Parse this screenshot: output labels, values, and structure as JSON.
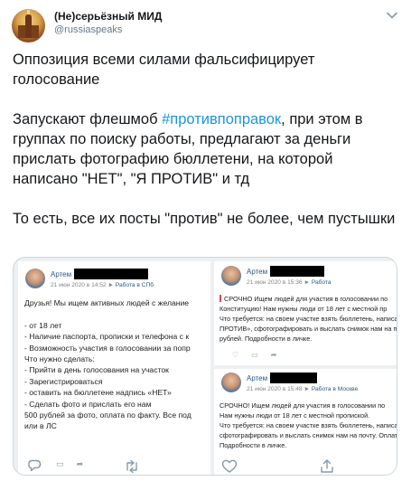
{
  "tweet": {
    "author_name": "(Не)серьёзный МИД",
    "author_handle": "@russiaspeaks",
    "paragraph1": "Оппозиция всеми силами фальсифицирует голосование",
    "paragraph2_before": "Запускают флешмоб ",
    "hashtag": "#противпоправок",
    "paragraph2_after": ", при этом в группах по поиску работы, предлагают за деньги прислать фотографию бюллетени, на которой написано \"НЕТ\", \"Я ПРОТИВ\" и тд",
    "paragraph3": "То есть, все их посты \"против\" не более, чем пустышки"
  },
  "media": {
    "post_left": {
      "author": "Артем",
      "date": "21 июн 2020 в 14:52",
      "arrow": "►",
      "group": "Работа в СПб",
      "lines": [
        "Друзья! Мы ищем активных людей с желание",
        "",
        "- от 18 лет",
        "- Наличие паспорта, прописки и телефона с к",
        "- Возможность участия в голосовании за попр",
        "Что нужно сделать:",
        "- Прийти в день голосования на участок",
        "- Зарегистрироваться",
        "- оставить на бюллетене надпись «НЕТ»",
        "- Сделать фото и прислать его нам",
        "500 рублей за фото, оплата по факту. Все под",
        "или в ЛС"
      ]
    },
    "post_right_top": {
      "author": "Артем",
      "date": "21 июн 2020 в 15:36",
      "arrow": "►",
      "group": "Работа",
      "lines": [
        "СРОЧНО  Ищем людей для участия в голосовании по",
        "Конституцию! Нам нужны люди от 18 лет с местной пр",
        "Что требуется: на своем участке взять бюллетень, написат",
        "ПРОТИВ», сфотографировать и выслать снимок нам на по",
        "рублей. Подробности в личке."
      ]
    },
    "post_right_bottom": {
      "author": "Артем",
      "date": "21 июн 2020 в 15:48",
      "arrow": "►",
      "group": "Работа в Москве",
      "lines": [
        "СРОЧНО! Ищем людей для участия в голосовании по",
        "Нам нужны люди от 18 лет с местной пропиской.",
        "Что требуется: на своем участке взять бюллетень, написа",
        "сфотографировать и выслать снимок нам на почту. Оплат",
        "Подробности в личке."
      ]
    }
  },
  "colors": {
    "hashtag": "#1b95e0",
    "secondary_text": "#657786",
    "vk_link": "#2a5885"
  },
  "icons": [
    "chevron-down-icon",
    "reply-icon",
    "retweet-icon",
    "like-icon",
    "share-icon"
  ]
}
